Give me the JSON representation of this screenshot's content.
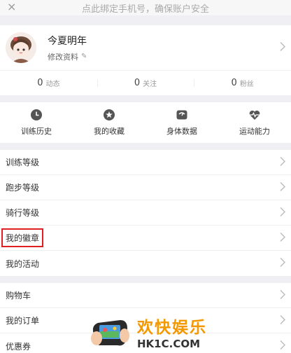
{
  "notice": {
    "text": "点此绑定手机号，确保账户安全"
  },
  "profile": {
    "name": "今夏明年",
    "edit_label": "修改资料"
  },
  "stats": [
    {
      "num": "0",
      "label": "动态"
    },
    {
      "num": "0",
      "label": "关注"
    },
    {
      "num": "0",
      "label": "粉丝"
    }
  ],
  "grid": [
    {
      "label": "训练历史",
      "icon": "clock-icon"
    },
    {
      "label": "我的收藏",
      "icon": "star-icon"
    },
    {
      "label": "身体数据",
      "icon": "body-data-icon"
    },
    {
      "label": "运动能力",
      "icon": "heart-pulse-icon"
    }
  ],
  "menu_group1": [
    {
      "label": "训练等级"
    },
    {
      "label": "跑步等级"
    },
    {
      "label": "骑行等级"
    },
    {
      "label": "我的徽章"
    },
    {
      "label": "我的活动"
    }
  ],
  "menu_group2": [
    {
      "label": "购物车"
    },
    {
      "label": "我的订单"
    },
    {
      "label": "优惠券"
    }
  ],
  "watermark": {
    "cn": "欢快娱乐",
    "en": "HK1C.COM"
  },
  "colors": {
    "highlight": "#e02020",
    "watermark": "#f39800",
    "icon": "#555555"
  }
}
